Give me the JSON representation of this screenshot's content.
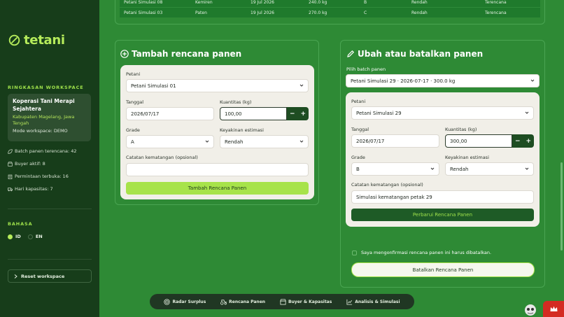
{
  "app": {
    "name": "tetani"
  },
  "sidebar": {
    "summary_title": "RINGKASAN WORKSPACE",
    "workspace": {
      "name": "Koperasi Tani Merapi Sejahtera",
      "location": "Kabupaten Magelang, Jawa Tengah",
      "mode": "Mode workspace: DEMO"
    },
    "stats": [
      {
        "icon": "leaf-icon",
        "text": "Batch panen terencana: 42"
      },
      {
        "icon": "store-icon",
        "text": "Buyer aktif: 8"
      },
      {
        "icon": "clipboard-icon",
        "text": "Permintaan terbuka: 16"
      },
      {
        "icon": "truck-icon",
        "text": "Hari kapasitas: 7"
      }
    ],
    "language_title": "BAHASA",
    "languages": [
      {
        "code": "ID",
        "selected": true
      },
      {
        "code": "EN",
        "selected": false
      }
    ],
    "reset_label": "Reset workspace"
  },
  "top_table": {
    "rows": [
      [
        "Petani Simulasi 08",
        "Kemiren",
        "19 Jul 2026",
        "240.0 kg",
        "B",
        "Rendah",
        "Terencana"
      ],
      [
        "Petani Simulasi 03",
        "Paten",
        "19 Jul 2026",
        "270.0 kg",
        "C",
        "Rendah",
        "Terencana"
      ]
    ]
  },
  "add_panel": {
    "title": "Tambah rencana panen",
    "farmer_label": "Petani",
    "farmer_value": "Petani Simulasi 01",
    "date_label": "Tanggal",
    "date_value": "2026/07/17",
    "qty_label": "Kuantitas (kg)",
    "qty_value": "100,00",
    "grade_label": "Grade",
    "grade_value": "A",
    "confidence_label": "Keyakinan estimasi",
    "confidence_value": "Rendah",
    "note_label": "Catatan kematangan (opsional)",
    "note_value": "",
    "submit_label": "Tambah Rencana Panen"
  },
  "edit_panel": {
    "title": "Ubah atau batalkan panen",
    "batch_label": "Pilih batch panen",
    "batch_value": "Petani Simulasi 29 · 2026-07-17 · 300.0 kg",
    "farmer_label": "Petani",
    "farmer_value": "Petani Simulasi 29",
    "date_label": "Tanggal",
    "date_value": "2026/07/17",
    "qty_label": "Kuantitas (kg)",
    "qty_value": "300,00",
    "grade_label": "Grade",
    "grade_value": "B",
    "confidence_label": "Keyakinan estimasi",
    "confidence_value": "Rendah",
    "note_label": "Catatan kematangan (opsional)",
    "note_value": "Simulasi kematangan petak 29",
    "update_label": "Perbarui Rencana Panen",
    "confirm_label": "Saya mengonfirmasi rencana panen ini harus dibatalkan.",
    "cancel_label": "Batalkan Rencana Panen"
  },
  "bottom_nav": [
    {
      "icon": "radar-icon",
      "label": "Radar Surplus"
    },
    {
      "icon": "tractor-icon",
      "label": "Rencana Panen"
    },
    {
      "icon": "store-icon",
      "label": "Buyer & Kapasitas"
    },
    {
      "icon": "chart-icon",
      "label": "Analisis & Simulasi"
    }
  ],
  "colors": {
    "background": "#2e8a35",
    "sidebar": "#173d1a",
    "accent_lime": "#a7e34a",
    "dark_green": "#1e5b26",
    "danger": "#d42b22"
  }
}
